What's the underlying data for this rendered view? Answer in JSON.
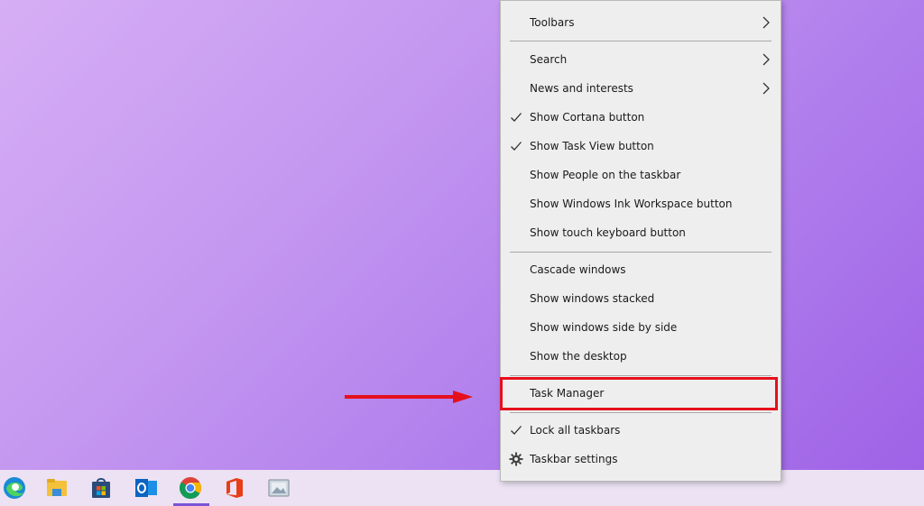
{
  "menu": {
    "items": [
      {
        "label": "Toolbars",
        "checked": false,
        "submenu": true
      },
      {
        "label": "Search",
        "checked": false,
        "submenu": true
      },
      {
        "label": "News and interests",
        "checked": false,
        "submenu": true
      },
      {
        "label": "Show Cortana button",
        "checked": true,
        "submenu": false
      },
      {
        "label": "Show Task View button",
        "checked": true,
        "submenu": false
      },
      {
        "label": "Show People on the taskbar",
        "checked": false,
        "submenu": false
      },
      {
        "label": "Show Windows Ink Workspace button",
        "checked": false,
        "submenu": false
      },
      {
        "label": "Show touch keyboard button",
        "checked": false,
        "submenu": false
      },
      {
        "label": "Cascade windows",
        "checked": false,
        "submenu": false
      },
      {
        "label": "Show windows stacked",
        "checked": false,
        "submenu": false
      },
      {
        "label": "Show windows side by side",
        "checked": false,
        "submenu": false
      },
      {
        "label": "Show the desktop",
        "checked": false,
        "submenu": false
      },
      {
        "label": "Task Manager",
        "checked": false,
        "submenu": false,
        "highlighted": true
      },
      {
        "label": "Lock all taskbars",
        "checked": true,
        "submenu": false
      },
      {
        "label": "Taskbar settings",
        "checked": false,
        "submenu": false,
        "icon": "gear-icon"
      }
    ]
  },
  "taskbar": {
    "icons": [
      "edge-icon",
      "file-explorer-icon",
      "microsoft-store-icon",
      "outlook-icon",
      "chrome-icon",
      "office-icon",
      "photos-icon"
    ],
    "active": "chrome-icon"
  },
  "annotations": {
    "highlight_color": "#e5101c",
    "arrow_color": "#e5101c"
  },
  "colors": {
    "menu_background": "#eeeeee",
    "taskbar_background": "#ece2f4",
    "active_indicator": "#7b54d8"
  }
}
